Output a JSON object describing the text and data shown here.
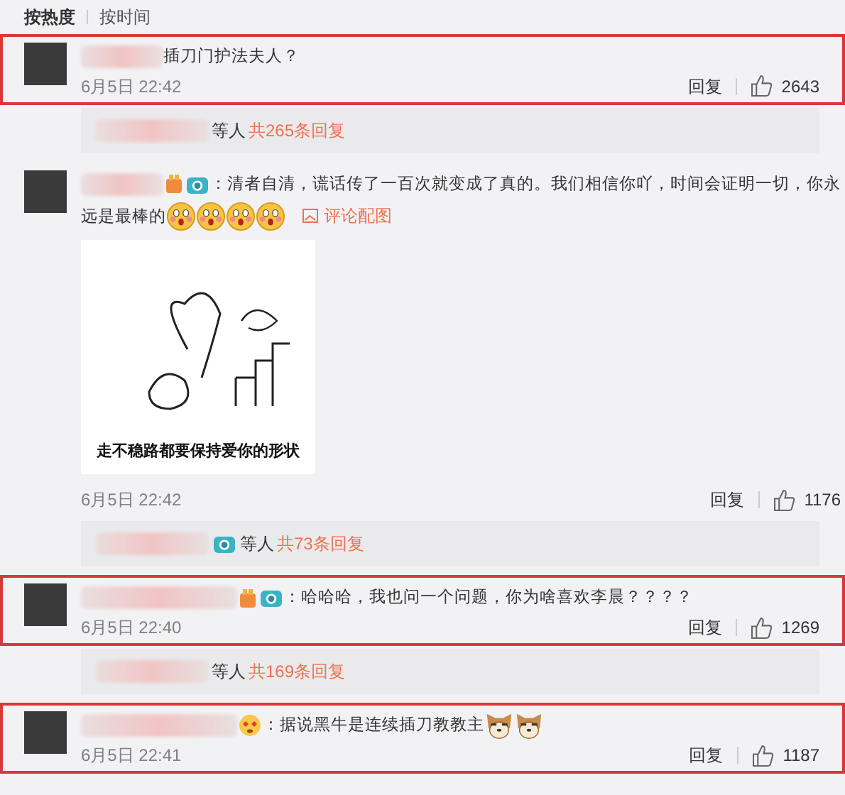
{
  "sort_tabs": [
    {
      "label": "按热度",
      "selected": true
    },
    {
      "label": "按时间",
      "selected": false
    }
  ],
  "comments": [
    {
      "highlighted": true,
      "text": "插刀门护法夫人？",
      "time": "6月5日 22:42",
      "reply": "回复",
      "likes": "2643",
      "thread": {
        "label": "等人",
        "count": "共265条回复"
      }
    },
    {
      "highlighted": false,
      "badges": [
        {
          "kind": "gift"
        },
        {
          "kind": "camera"
        }
      ],
      "text": "：清者自清，谎话传了一百次就变成了真的。我们相信你吖，时间会证明一切，你永",
      "text_continued": "远是最棒的",
      "emojis": [
        {
          "kind": "surprised"
        },
        {
          "kind": "surprised"
        },
        {
          "kind": "surprised"
        },
        {
          "kind": "surprised"
        }
      ],
      "link": "评论配图",
      "image": {
        "caption": "走不稳路都要保持爱你的形状"
      },
      "time": "6月5日 22:42",
      "reply": "回复",
      "likes": "1176",
      "thread": {
        "badges": [
          {
            "kind": "camera"
          }
        ],
        "label": "等人",
        "count": "共73条回复"
      }
    },
    {
      "highlighted": true,
      "badges": [
        {
          "kind": "gift"
        },
        {
          "kind": "camera"
        }
      ],
      "text": "：哈哈哈，我也问一个问题，你为啥喜欢李晨？？？？",
      "time": "6月5日 22:40",
      "reply": "回复",
      "likes": "1269",
      "thread": {
        "label": "等人",
        "count": "共169条回复"
      }
    },
    {
      "highlighted": true,
      "badges": [
        {
          "kind": "heart"
        }
      ],
      "text": "：据说黑牛是连续插刀教教主",
      "emojis": [
        {
          "kind": "dog"
        },
        {
          "kind": "dog"
        }
      ],
      "time": "6月5日 22:41",
      "reply": "回复",
      "likes": "1187"
    }
  ]
}
